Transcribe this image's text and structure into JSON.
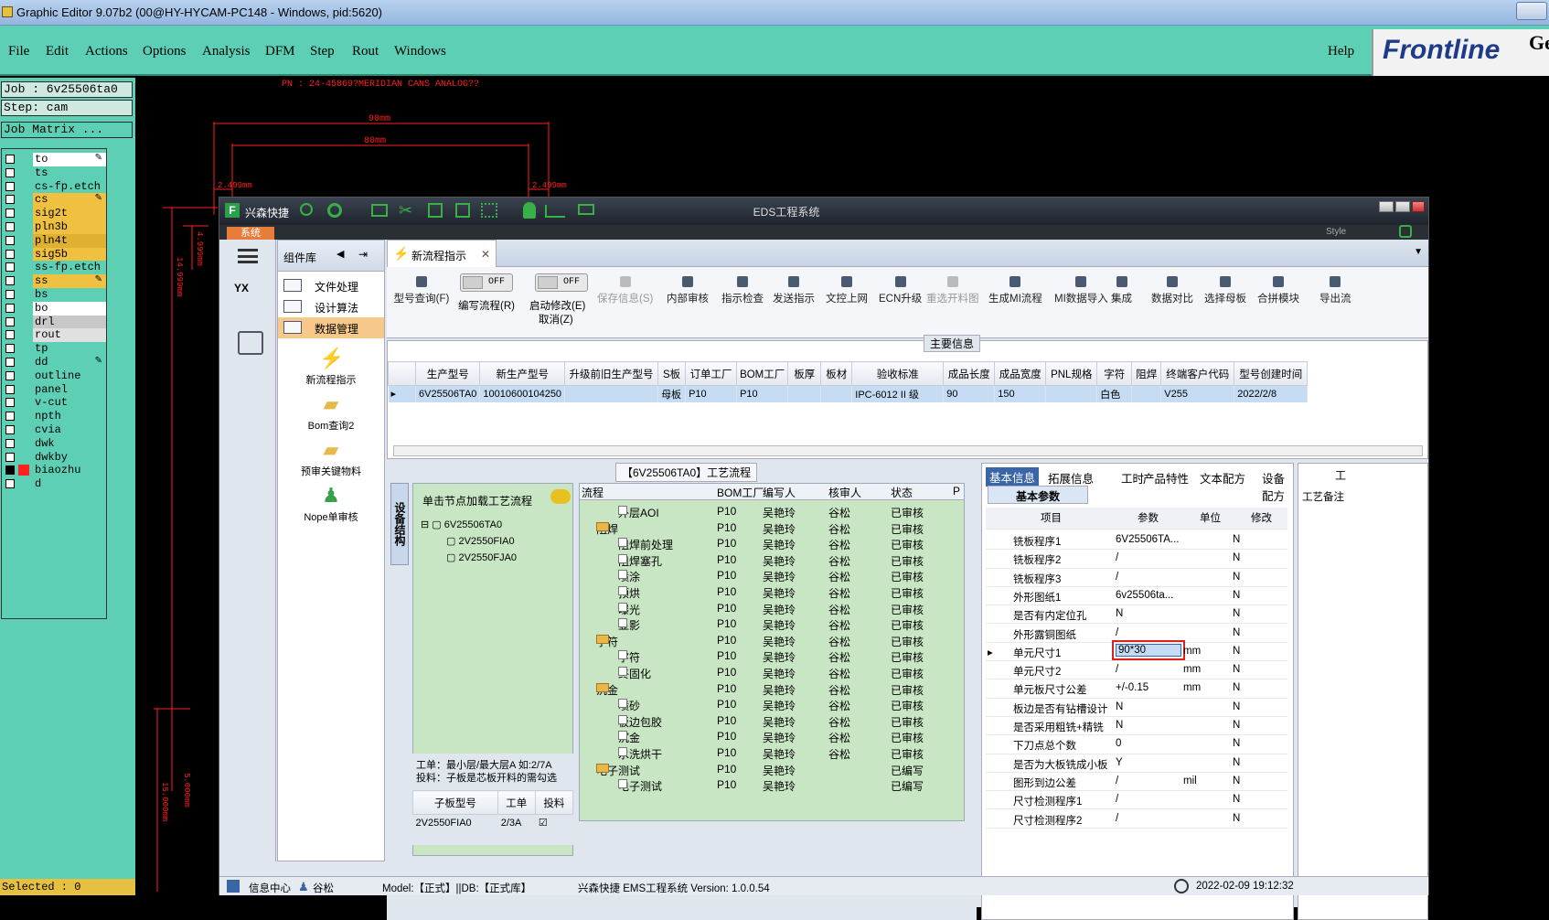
{
  "window": {
    "title": "Graphic Editor 9.07b2 (00@HY-HYCAM-PC148 - Windows, pid:5620)"
  },
  "menu": {
    "items": [
      "File",
      "Edit",
      "Actions",
      "Options",
      "Analysis",
      "DFM",
      "Step",
      "Rout",
      "Windows"
    ],
    "help": "Help"
  },
  "logo": {
    "text": "Frontline",
    "suffix": "Ge"
  },
  "job": {
    "job_line": "Job : 6v25506ta0",
    "step_line": "Step: cam",
    "matrix_btn": "Job Matrix ..."
  },
  "layers": [
    {
      "name": "to",
      "color": "#ffffff",
      "edit": true
    },
    {
      "name": "ts",
      "color": "#5ccfb4"
    },
    {
      "name": "cs-fp.etch",
      "color": "#5ccfb4"
    },
    {
      "name": "cs",
      "color": "#f0c040",
      "edit": true
    },
    {
      "name": "sig2t",
      "color": "#f0c040"
    },
    {
      "name": "pln3b",
      "color": "#f0c040"
    },
    {
      "name": "pln4t",
      "color": "#e0b030"
    },
    {
      "name": "sig5b",
      "color": "#f0c040"
    },
    {
      "name": "ss-fp.etch",
      "color": "#5ccfb4"
    },
    {
      "name": "ss",
      "color": "#f0c040",
      "edit": true
    },
    {
      "name": "bs",
      "color": "#5ccfb4"
    },
    {
      "name": "bo",
      "color": "#ffffff"
    },
    {
      "name": "drl",
      "color": "#c8c8c8"
    },
    {
      "name": "rout",
      "color": "#e0e0e0"
    },
    {
      "name": "tp",
      "color": "#5ccfb4"
    },
    {
      "name": "dd",
      "color": "#5ccfb4",
      "edit": true
    },
    {
      "name": "outline",
      "color": "#5ccfb4"
    },
    {
      "name": "panel",
      "color": "#5ccfb4"
    },
    {
      "name": "v-cut",
      "color": "#5ccfb4"
    },
    {
      "name": "npth",
      "color": "#5ccfb4"
    },
    {
      "name": "cvia",
      "color": "#5ccfb4"
    },
    {
      "name": "dwk",
      "color": "#5ccfb4"
    },
    {
      "name": "dwkby",
      "color": "#5ccfb4"
    },
    {
      "name": "biaozhu",
      "color": "#5ccfb4",
      "active": true
    },
    {
      "name": "d",
      "color": "#5ccfb4"
    }
  ],
  "status": {
    "selected": "Selected : 0"
  },
  "cad": {
    "pn": "PN :  24-45869?MERIDIAN CANS ANALOG??",
    "dim1": "90mm",
    "dim2": "80mm",
    "dim3": "2.499mm",
    "dim4": "2.499mm",
    "dim5": "4.999mm",
    "dim6": "14.999mm",
    "dim7": "15.000mm",
    "dim8": "5.000mm"
  },
  "app": {
    "brand": "兴森快捷",
    "title": "EDS工程系统",
    "system_tab": "系统",
    "style_label": "Style",
    "complib": {
      "title": "组件库",
      "items": [
        "文件处理",
        "设计算法",
        "数据管理"
      ],
      "big": [
        "新流程指示",
        "Bom查询2",
        "预审关键物料",
        "Nope单审核"
      ]
    },
    "doc_tab": "新流程指示",
    "toolbar": {
      "query": "型号查询(F)",
      "toggle1": {
        "state": "OFF",
        "label": "编写流程(R)"
      },
      "toggle2": {
        "state": "OFF",
        "label1": "启动修改(E)",
        "label2": "取消(Z)"
      },
      "buttons": [
        "保存信息(S)",
        "内部审核",
        "指示检查",
        "发送指示",
        "文控上网",
        "ECN升级",
        "重选开料图",
        "生成MI流程",
        "MI数据导入",
        "集成",
        "数据对比",
        "选择母板",
        "合拼模块",
        "导出流"
      ]
    },
    "main_info": {
      "title": "主要信息",
      "columns": [
        "生产型号",
        "新生产型号",
        "升级前旧生产型号",
        "S板",
        "订单工厂",
        "BOM工厂",
        "板厚",
        "板材",
        "验收标准",
        "成品长度",
        "成品宽度",
        "PNL规格",
        "字符",
        "阻焊",
        "终端客户代码",
        "型号创建时间"
      ],
      "row": [
        "6V25506TA0",
        "10010600104250",
        "",
        "母板",
        "P10",
        "P10",
        "",
        "",
        "IPC-6012 II 级",
        "90",
        "150",
        "",
        "白色",
        "",
        "V255",
        "2022/2/8"
      ]
    },
    "process": {
      "title": "【6V25506TA0】工艺流程",
      "side_tab": "设备结构",
      "load_hint": "单击节点加载工艺流程",
      "tree_root": "6V25506TA0",
      "tree_children": [
        "2V2550FIA0",
        "2V2550FJA0"
      ],
      "note1": "工单：最小层/最大层A 如:2/7A",
      "note2": "投料：子板是芯板开料的需勾选",
      "sub_headers": [
        "子板型号",
        "工单",
        "投料"
      ],
      "sub_row": [
        "2V2550FIA0",
        "2/3A",
        ""
      ],
      "list_headers": [
        "流程",
        "BOM工厂",
        "编写人",
        "核审人",
        "状态",
        "P"
      ],
      "rows": [
        {
          "indent": 2,
          "name": "外层AOI",
          "f": "P10",
          "w": "吴艳玲",
          "r": "谷松",
          "s": "已审核"
        },
        {
          "indent": 1,
          "folder": true,
          "name": "阻焊",
          "f": "P10",
          "w": "吴艳玲",
          "r": "谷松",
          "s": "已审核"
        },
        {
          "indent": 2,
          "name": "阻焊前处理",
          "f": "P10",
          "w": "吴艳玲",
          "r": "谷松",
          "s": "已审核"
        },
        {
          "indent": 2,
          "name": "阻焊塞孔",
          "f": "P10",
          "w": "吴艳玲",
          "r": "谷松",
          "s": "已审核"
        },
        {
          "indent": 2,
          "name": "喷涂",
          "f": "P10",
          "w": "吴艳玲",
          "r": "谷松",
          "s": "已审核"
        },
        {
          "indent": 2,
          "name": "预烘",
          "f": "P10",
          "w": "吴艳玲",
          "r": "谷松",
          "s": "已审核"
        },
        {
          "indent": 2,
          "name": "曝光",
          "f": "P10",
          "w": "吴艳玲",
          "r": "谷松",
          "s": "已审核"
        },
        {
          "indent": 2,
          "name": "显影",
          "f": "P10",
          "w": "吴艳玲",
          "r": "谷松",
          "s": "已审核"
        },
        {
          "indent": 1,
          "folder": true,
          "name": "字符",
          "f": "P10",
          "w": "吴艳玲",
          "r": "谷松",
          "s": "已审核"
        },
        {
          "indent": 2,
          "name": "字符",
          "f": "P10",
          "w": "吴艳玲",
          "r": "谷松",
          "s": "已审核"
        },
        {
          "indent": 2,
          "name": "终固化",
          "f": "P10",
          "w": "吴艳玲",
          "r": "谷松",
          "s": "已审核"
        },
        {
          "indent": 1,
          "folder": true,
          "name": "沉金",
          "f": "P10",
          "w": "吴艳玲",
          "r": "谷松",
          "s": "已审核"
        },
        {
          "indent": 2,
          "name": "喷砂",
          "f": "P10",
          "w": "吴艳玲",
          "r": "谷松",
          "s": "已审核"
        },
        {
          "indent": 2,
          "name": "板边包胶",
          "f": "P10",
          "w": "吴艳玲",
          "r": "谷松",
          "s": "已审核"
        },
        {
          "indent": 2,
          "name": "沉金",
          "f": "P10",
          "w": "吴艳玲",
          "r": "谷松",
          "s": "已审核"
        },
        {
          "indent": 2,
          "name": "水洗烘干",
          "f": "P10",
          "w": "吴艳玲",
          "r": "谷松",
          "s": "已审核"
        },
        {
          "indent": 1,
          "folder": true,
          "name": "电子测试",
          "f": "P10",
          "w": "吴艳玲",
          "r": "",
          "s": "已编写"
        },
        {
          "indent": 2,
          "name": "电子测试",
          "f": "P10",
          "w": "吴艳玲",
          "r": "",
          "s": "已编写"
        }
      ]
    },
    "basic": {
      "tabs": [
        "基本信息",
        "拓展信息",
        "工时",
        "产品特性",
        "文本配方",
        "设备配方"
      ],
      "subtab": "基本参数",
      "headers": [
        "项目",
        "参数",
        "单位",
        "修改"
      ],
      "rows": [
        {
          "item": "铣板程序1",
          "param": "6V25506TA...",
          "unit": "",
          "mod": "N"
        },
        {
          "item": "铣板程序2",
          "param": "/",
          "unit": "",
          "mod": "N"
        },
        {
          "item": "铣板程序3",
          "param": "/",
          "unit": "",
          "mod": "N"
        },
        {
          "item": "外形图纸1",
          "param": "6v25506ta...",
          "unit": "",
          "mod": "N"
        },
        {
          "item": "是否有内定位孔",
          "param": "N",
          "unit": "",
          "mod": "N"
        },
        {
          "item": "外形露铜图纸",
          "param": "/",
          "unit": "",
          "mod": "N"
        },
        {
          "item": "单元尺寸1",
          "param": "90*30",
          "unit": "mm",
          "mod": "N",
          "selected": true
        },
        {
          "item": "单元尺寸2",
          "param": "/",
          "unit": "mm",
          "mod": "N"
        },
        {
          "item": "单元板尺寸公差",
          "param": "+/-0.15",
          "unit": "mm",
          "mod": "N"
        },
        {
          "item": "板边是否有钻槽设计",
          "param": "N",
          "unit": "",
          "mod": "N"
        },
        {
          "item": "是否采用粗铣+精铣",
          "param": "N",
          "unit": "",
          "mod": "N"
        },
        {
          "item": "下刀点总个数",
          "param": "0",
          "unit": "",
          "mod": "N"
        },
        {
          "item": "是否为大板铣成小板",
          "param": "Y",
          "unit": "",
          "mod": "N"
        },
        {
          "item": "图形到边公差",
          "param": "/",
          "unit": "mil",
          "mod": "N"
        },
        {
          "item": "尺寸检测程序1",
          "param": "/",
          "unit": "",
          "mod": "N"
        },
        {
          "item": "尺寸检测程序2",
          "param": "/",
          "unit": "",
          "mod": "N"
        }
      ]
    },
    "right": {
      "tab": "工",
      "label": "工艺备注"
    },
    "statusbar": {
      "info": "信息中心",
      "user": "谷松",
      "model": "Model:【正式】||DB:【正式库】",
      "brand": "兴森快捷 EMS工程系统 Version: 1.0.0.54",
      "time": "2022-02-09 19:12:32"
    }
  }
}
